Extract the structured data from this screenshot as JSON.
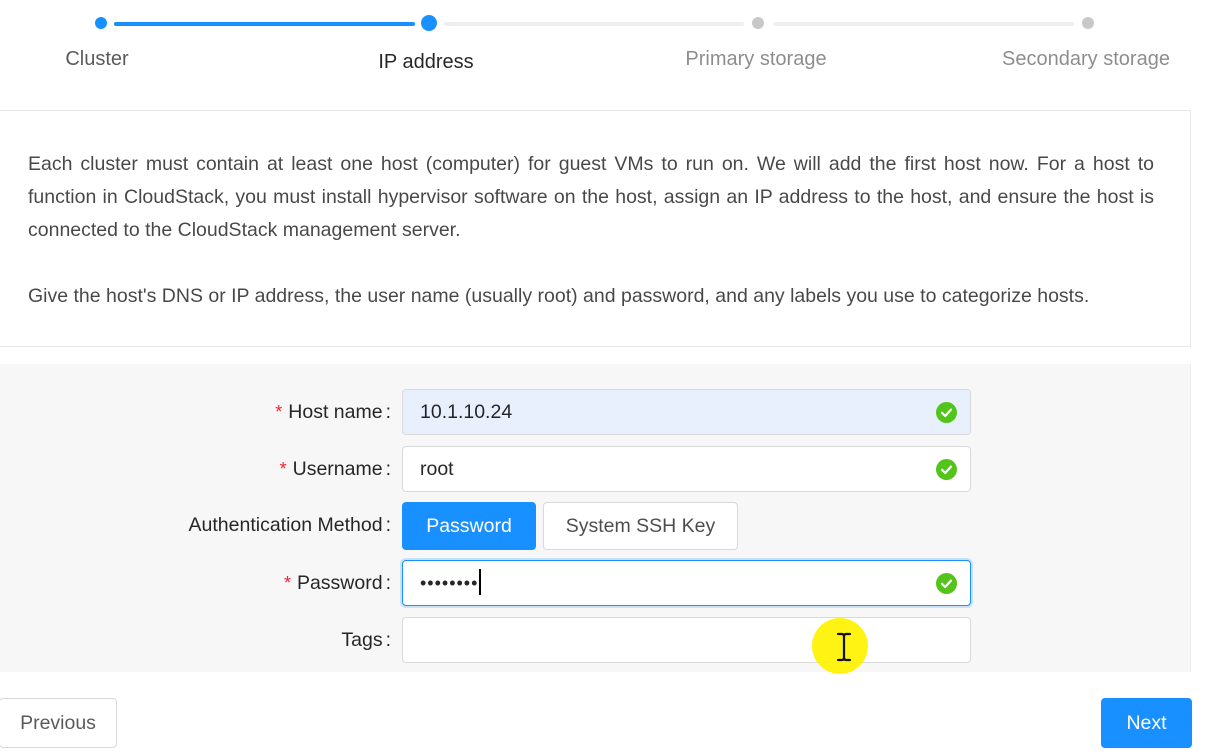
{
  "steps": [
    {
      "label": "Cluster",
      "status": "done"
    },
    {
      "label": "IP address",
      "status": "active"
    },
    {
      "label": "Primary storage",
      "status": "wait"
    },
    {
      "label": "Secondary storage",
      "status": "wait"
    }
  ],
  "description": {
    "paragraph1": "Each cluster must contain at least one host (computer) for guest VMs to run on. We will add the first host now. For a host to function in CloudStack, you must install hypervisor software on the host, assign an IP address to the host, and ensure the host is connected to the CloudStack management server.",
    "paragraph2": "Give the host's DNS or IP address, the user name (usually root) and password, and any labels you use to categorize hosts."
  },
  "form": {
    "required_mark": "*",
    "colon": ":",
    "host_name": {
      "label": "Host name",
      "value": "10.1.10.24"
    },
    "username": {
      "label": "Username",
      "value": "root"
    },
    "auth_method": {
      "label": "Authentication Method",
      "options": [
        "Password",
        "System SSH Key"
      ],
      "selected": "Password"
    },
    "password": {
      "label": "Password",
      "masked_value": "••••••••"
    },
    "tags": {
      "label": "Tags",
      "value": ""
    }
  },
  "footer": {
    "previous_label": "Previous",
    "next_label": "Next"
  },
  "colors": {
    "primary": "#1890ff",
    "success": "#52c41a",
    "required": "#f5222d",
    "autofill_bg": "#e8f0fe",
    "cursor_highlight": "#fff200"
  },
  "icons": {
    "valid": "check-circle-icon",
    "cursor": "text-cursor-icon"
  }
}
